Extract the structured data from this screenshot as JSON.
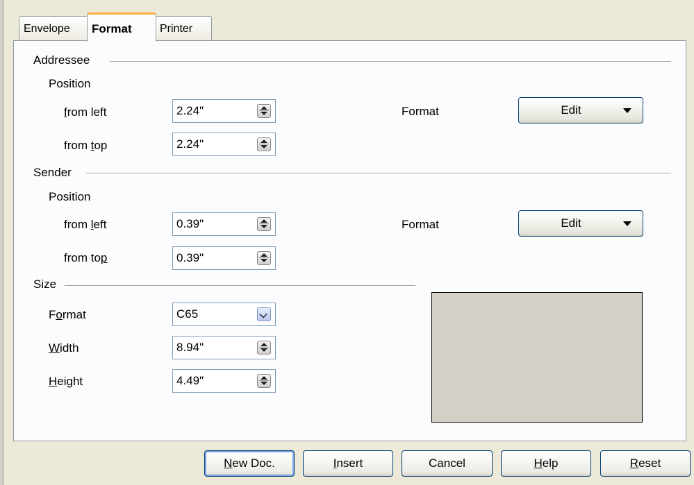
{
  "tabs": [
    {
      "label": "Envelope",
      "active": false
    },
    {
      "label": "Format",
      "active": true
    },
    {
      "label": "Printer",
      "active": false
    }
  ],
  "addressee": {
    "heading": "Addressee",
    "position_label": "Position",
    "from_left": {
      "label_prefix": "",
      "label_mnemonic": "f",
      "label_rest": "rom left",
      "value": "2.24\""
    },
    "from_top": {
      "label_prefix": "from ",
      "label_mnemonic": "t",
      "label_rest": "op",
      "value": "2.24\""
    },
    "format_label": "Format",
    "edit_label": "Edit"
  },
  "sender": {
    "heading": "Sender",
    "position_label": "Position",
    "from_left": {
      "label_prefix": "from ",
      "label_mnemonic": "l",
      "label_rest": "eft",
      "value": "0.39\""
    },
    "from_top": {
      "label_prefix": "from to",
      "label_mnemonic": "p",
      "label_rest": "",
      "value": "0.39\""
    },
    "format_label": "Format",
    "edit_label": "Edit"
  },
  "size": {
    "heading": "Size",
    "format": {
      "label_prefix": "F",
      "label_mnemonic": "o",
      "label_rest": "rmat",
      "value": "C65"
    },
    "width": {
      "label_prefix": "",
      "label_mnemonic": "W",
      "label_rest": "idth",
      "value": "8.94\""
    },
    "height": {
      "label_prefix": "",
      "label_mnemonic": "H",
      "label_rest": "eight",
      "value": "4.49\""
    }
  },
  "buttons": {
    "new_doc": {
      "mnemonic": "N",
      "rest": "ew Doc."
    },
    "insert": {
      "mnemonic": "I",
      "rest": "nsert"
    },
    "cancel": {
      "label": "Cancel"
    },
    "help": {
      "mnemonic": "H",
      "rest": "elp"
    },
    "reset": {
      "mnemonic": "R",
      "rest": "eset"
    }
  },
  "colors": {
    "active_tab_accent": "#f8b040",
    "dialog_bg": "#ece9d8",
    "panel_bg": "#fcfcfe",
    "preview_bg": "#d4d0c8"
  }
}
